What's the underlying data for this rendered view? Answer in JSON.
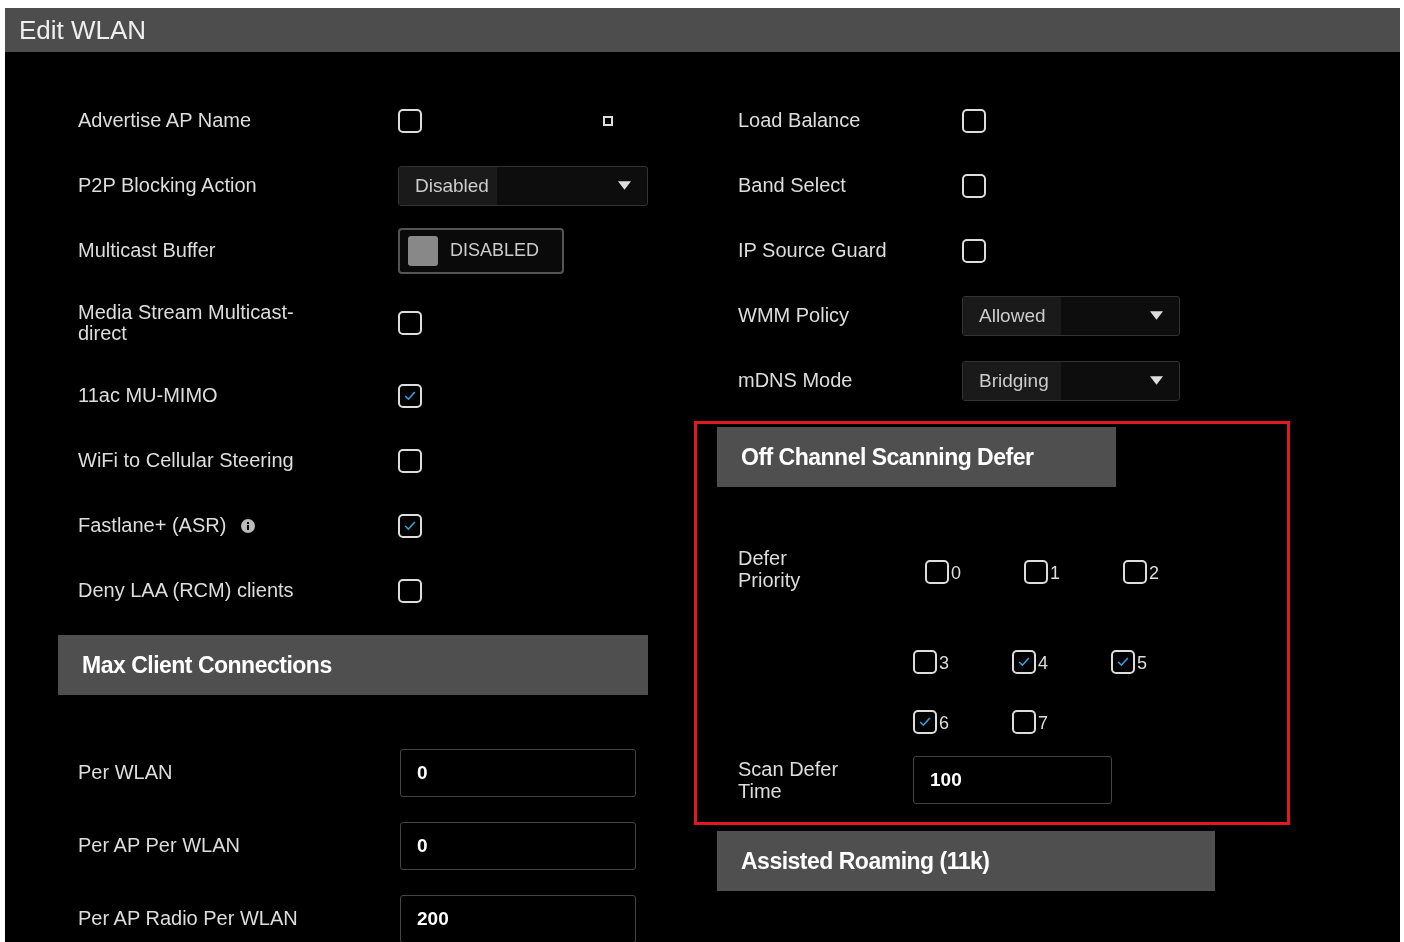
{
  "window": {
    "title": "Edit WLAN"
  },
  "left_settings": [
    {
      "label": "Advertise AP Name",
      "kind": "checkbox",
      "checked": false,
      "mark": true
    },
    {
      "label": "P2P Blocking Action",
      "kind": "select",
      "value": "Disabled"
    },
    {
      "label": "Multicast Buffer",
      "kind": "toggle",
      "on": false,
      "value": "DISABLED"
    },
    {
      "label": "Media Stream Multicast-direct",
      "kind": "checkbox",
      "checked": false
    },
    {
      "label": "11ac MU-MIMO",
      "kind": "checkbox",
      "checked": true
    },
    {
      "label": "WiFi to Cellular Steering",
      "kind": "checkbox",
      "checked": false
    },
    {
      "label": "Fastlane+ (ASR)",
      "kind": "checkbox",
      "checked": true,
      "info": true
    },
    {
      "label": "Deny LAA (RCM) clients",
      "kind": "checkbox",
      "checked": false
    }
  ],
  "max_client_connections": {
    "title": "Max Client Connections",
    "fields": [
      {
        "label": "Per WLAN",
        "value": "0"
      },
      {
        "label": "Per AP Per WLAN",
        "value": "0"
      },
      {
        "label": "Per AP Radio Per WLAN",
        "value": "200"
      }
    ]
  },
  "right_settings": [
    {
      "label": "Load Balance",
      "kind": "checkbox",
      "checked": false
    },
    {
      "label": "Band Select",
      "kind": "checkbox",
      "checked": false
    },
    {
      "label": "IP Source Guard",
      "kind": "checkbox",
      "checked": false
    },
    {
      "label": "WMM Policy",
      "kind": "select",
      "value": "Allowed"
    },
    {
      "label": "mDNS Mode",
      "kind": "select",
      "value": "Bridging"
    }
  ],
  "off_channel_scanning_defer": {
    "title": "Off Channel Scanning Defer",
    "highlighted": true,
    "priority_label": "Defer Priority",
    "priorities": [
      {
        "label": "0",
        "checked": false
      },
      {
        "label": "1",
        "checked": false
      },
      {
        "label": "2",
        "checked": false
      },
      {
        "label": "3",
        "checked": false
      },
      {
        "label": "4",
        "checked": true
      },
      {
        "label": "5",
        "checked": true
      },
      {
        "label": "6",
        "checked": true
      },
      {
        "label": "7",
        "checked": false
      }
    ],
    "scan_label": "Scan Defer Time",
    "scan_value": "100"
  },
  "assisted_roaming": {
    "title": "Assisted Roaming (11k)"
  }
}
